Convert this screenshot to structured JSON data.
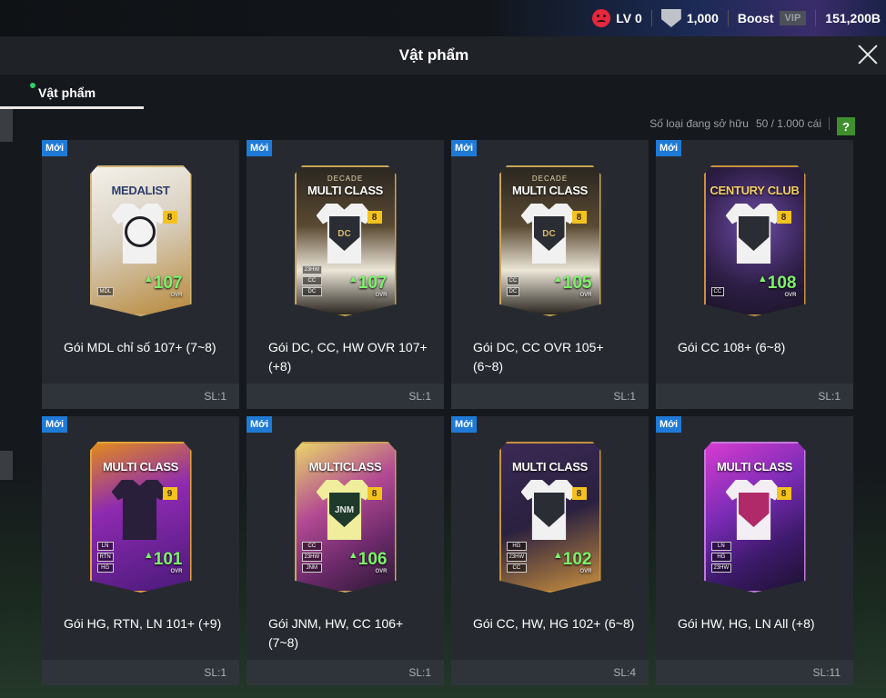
{
  "status": {
    "level_label": "LV 0",
    "coins": "1,000",
    "boost_label": "Boost",
    "vip_label": "VIP",
    "balance": "151,200B"
  },
  "header": {
    "title": "Vật phẩm"
  },
  "tabs": [
    {
      "label": "Vật phẩm",
      "active": true
    }
  ],
  "ownership": {
    "label": "Số loại đang sở hữu",
    "value": "50 / 1.000 cái",
    "help": "?"
  },
  "items": [
    {
      "badge": "Mới",
      "card_sub": "",
      "card_title": "MEDALIST",
      "level": "8",
      "ovr": "107",
      "ovr_label": "OVR",
      "tags": [
        "MDL"
      ],
      "crest": "",
      "name": "Gói MDL chỉ số 107+ (7~8)",
      "qty": "SL:1"
    },
    {
      "badge": "Mới",
      "card_sub": "DECADE",
      "card_title": "MULTI CLASS",
      "level": "8",
      "ovr": "107",
      "ovr_label": "OVR",
      "tags": [
        "23HW",
        "CC",
        "DC"
      ],
      "crest": "DC",
      "name": "Gói DC, CC, HW OVR 107+ (+8)",
      "qty": "SL:1"
    },
    {
      "badge": "Mới",
      "card_sub": "DECADE",
      "card_title": "MULTI CLASS",
      "level": "8",
      "ovr": "105",
      "ovr_label": "OVR",
      "tags": [
        "CC",
        "DC"
      ],
      "crest": "DC",
      "name": "Gói DC, CC OVR 105+ (6~8)",
      "qty": "SL:1"
    },
    {
      "badge": "Mới",
      "card_sub": "",
      "card_title": "CENTURY CLUB",
      "level": "8",
      "ovr": "108",
      "ovr_label": "OVR",
      "tags": [
        "CC"
      ],
      "crest": "",
      "name": "Gói CC 108+ (6~8)",
      "qty": "SL:1"
    },
    {
      "badge": "Mới",
      "card_sub": "",
      "card_title": "MULTI CLASS",
      "level": "9",
      "ovr": "101",
      "ovr_label": "OVR",
      "tags": [
        "LN",
        "RTN",
        "HG"
      ],
      "crest": "",
      "name": "Gói HG, RTN, LN 101+ (+9)",
      "qty": "SL:1"
    },
    {
      "badge": "Mới",
      "card_sub": "",
      "card_title": "MULTICLASS",
      "level": "8",
      "ovr": "106",
      "ovr_label": "OVR",
      "tags": [
        "CC",
        "23HW",
        "JNM"
      ],
      "crest": "JNM",
      "name": "Gói JNM, HW, CC 106+ (7~8)",
      "qty": "SL:1"
    },
    {
      "badge": "Mới",
      "card_sub": "",
      "card_title": "MULTI CLASS",
      "level": "8",
      "ovr": "102",
      "ovr_label": "OVR",
      "tags": [
        "HG",
        "23HW",
        "CC"
      ],
      "crest": "",
      "name": "Gói CC, HW, HG 102+ (6~8)",
      "qty": "SL:4"
    },
    {
      "badge": "Mới",
      "card_sub": "",
      "card_title": "MULTI CLASS",
      "level": "8",
      "ovr": "",
      "ovr_label": "",
      "tags": [
        "LN",
        "HG",
        "23HW"
      ],
      "crest": "",
      "name": "Gói HW, HG, LN All (+8)",
      "qty": "SL:11"
    }
  ]
}
